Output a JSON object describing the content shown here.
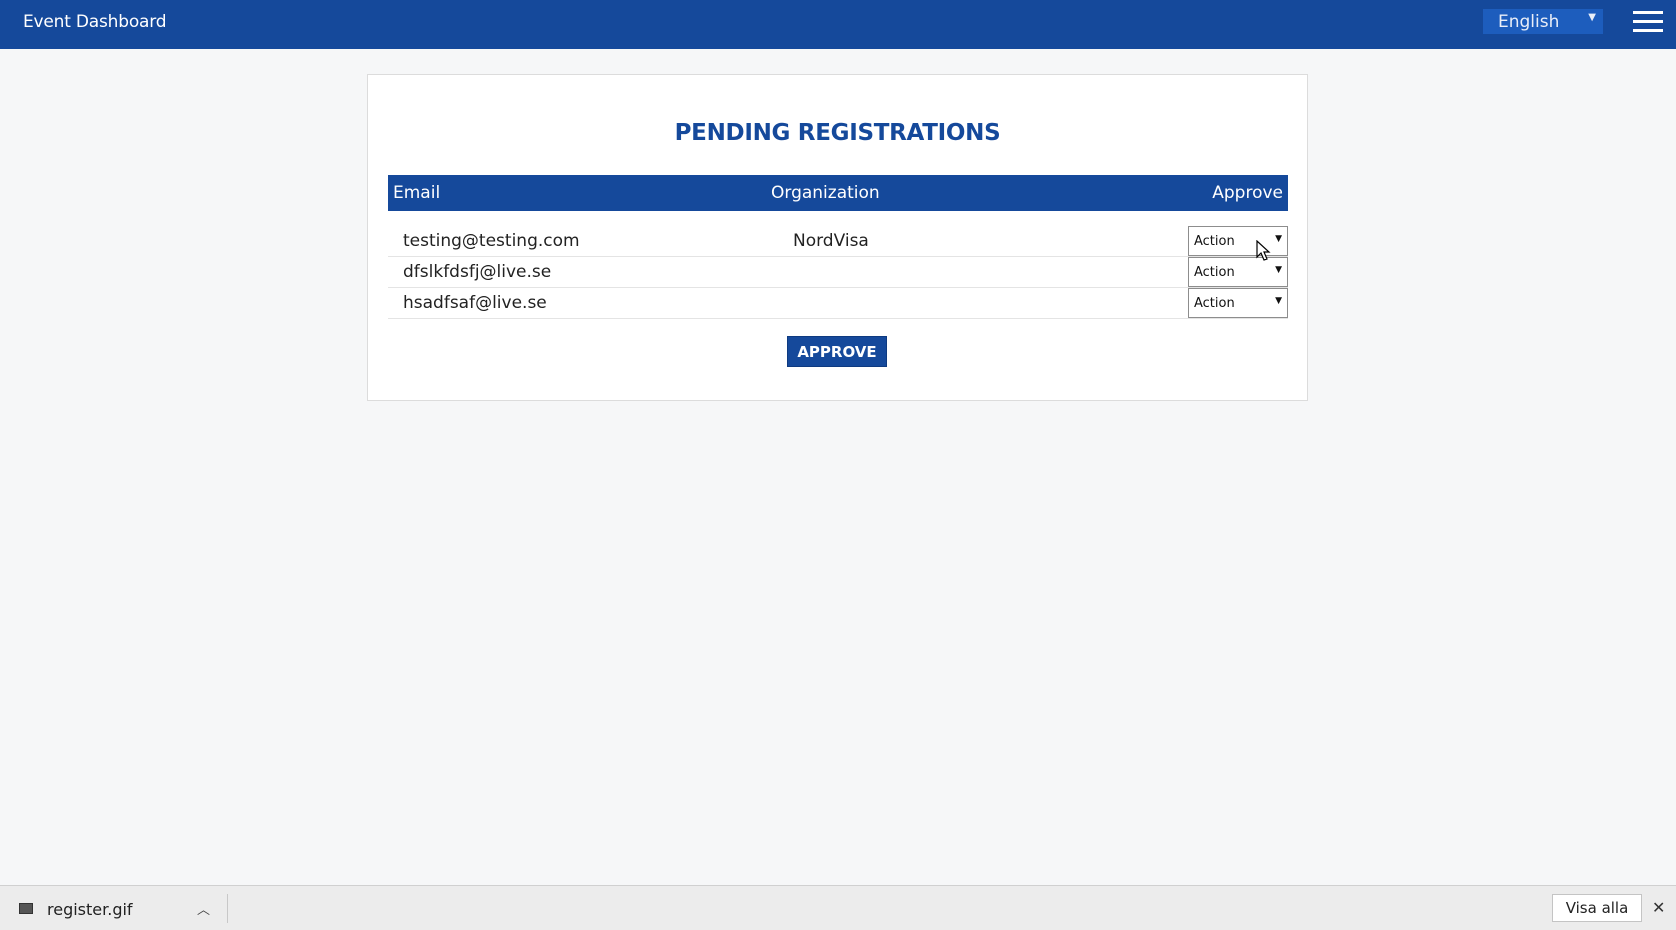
{
  "header": {
    "title": "Event Dashboard",
    "language": "English"
  },
  "main": {
    "title": "PENDING REGISTRATIONS",
    "columns": {
      "email": "Email",
      "organization": "Organization",
      "approve": "Approve"
    },
    "rows": [
      {
        "email": "testing@testing.com",
        "organization": "NordVisa",
        "action": "Action"
      },
      {
        "email": "dfslkfdsfj@live.se",
        "organization": "",
        "action": "Action"
      },
      {
        "email": "hsadfsaf@live.se",
        "organization": "",
        "action": "Action"
      }
    ],
    "approve_button": "APPROVE"
  },
  "download_bar": {
    "file_name": "register.gif",
    "show_all": "Visa alla"
  },
  "colors": {
    "primary": "#15499b",
    "background": "#f6f7f8"
  }
}
